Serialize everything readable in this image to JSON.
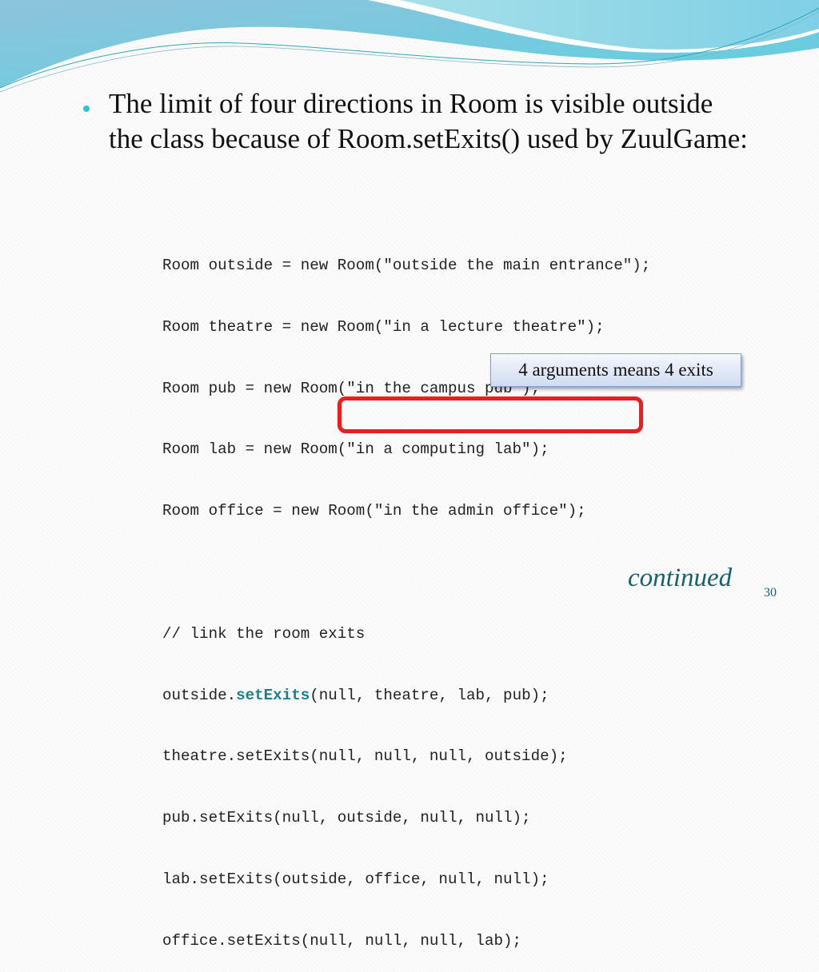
{
  "slide": {
    "bullet": "The limit of four directions in Room is visible outside the class because of Room.setExits() used by ZuulGame:",
    "code": {
      "lines": [
        {
          "text": "Room outside = new Room(\"outside the main entrance\");"
        },
        {
          "text": "Room theatre = new Room(\"in a lecture theatre\");"
        },
        {
          "text": "Room pub = new Room(\"in the campus pub\");"
        },
        {
          "text": "Room lab = new Room(\"in a computing lab\");"
        },
        {
          "text": "Room office = new Room(\"in the admin office\");"
        },
        {
          "text": ""
        },
        {
          "text": "// link the room exits"
        },
        {
          "prefix": "outside.",
          "keyword": "setExits",
          "suffix": "(null, theatre, lab, pub);"
        },
        {
          "text": "theatre.setExits(null, null, null, outside);"
        },
        {
          "text": "pub.setExits(null, outside, null, null);"
        },
        {
          "text": "lab.setExits(outside, office, null, null);"
        },
        {
          "text": "office.setExits(null, null, null, lab);"
        }
      ]
    },
    "callout": "4 arguments means 4 exits",
    "continued": "continued",
    "page_number": "30"
  },
  "colors": {
    "bullet": "#2cc4d8",
    "keyword": "#1a7f8e",
    "highlight_border": "#ee1c1c",
    "footer_text": "#17606e"
  }
}
